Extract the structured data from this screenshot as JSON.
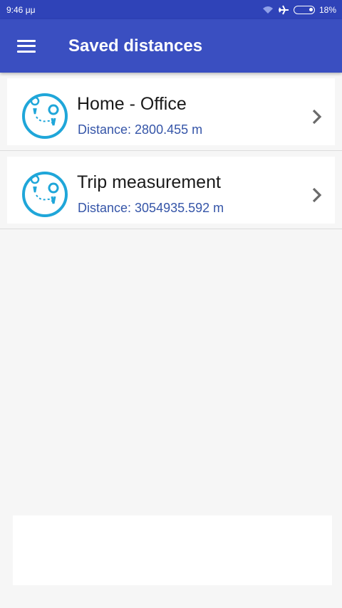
{
  "status_bar": {
    "time": "9:46 μμ",
    "battery": "18%",
    "icons": [
      "wifi-icon",
      "airplane-icon",
      "battery-icon"
    ]
  },
  "app_bar": {
    "title": "Saved distances",
    "menu_icon": "hamburger-menu-icon"
  },
  "colors": {
    "primary": "#3a4fc1",
    "status_bar": "#2f43b8",
    "accent": "#1fa6d9",
    "subtitle": "#3555a8"
  },
  "items": [
    {
      "title": "Home - Office",
      "distance": "Distance: 2800.455 m"
    },
    {
      "title": "Trip measurement",
      "distance": "Distance: 3054935.592 m"
    }
  ]
}
